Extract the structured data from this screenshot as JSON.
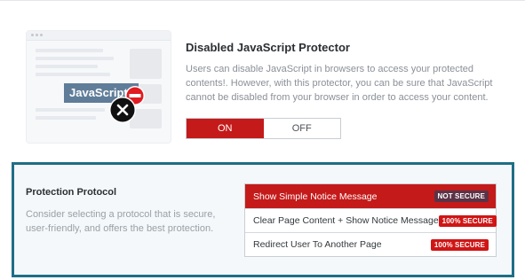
{
  "illustration": {
    "label": "JavaScript",
    "icons": [
      "no-entry-icon",
      "close-circle-icon"
    ]
  },
  "protector": {
    "title": "Disabled JavaScript Protector",
    "description": "Users can disable JavaScript in browsers to access your protected contents!. However, with this protector, you can be sure that JavaScript cannot be disabled from your browser in order to access your content.",
    "toggle": {
      "on_label": "ON",
      "off_label": "OFF",
      "selected": "ON"
    }
  },
  "protocol": {
    "title": "Protection Protocol",
    "description": "Consider selecting a protocol that is secure, user-friendly, and offers the best protection.",
    "options": [
      {
        "label": "Show Simple Notice Message",
        "badge": "NOT SECURE",
        "selected": true
      },
      {
        "label": "Clear Page Content + Show Notice Message",
        "badge": "100% SECURE",
        "selected": false
      },
      {
        "label": "Redirect User To Another Page",
        "badge": "100% SECURE",
        "selected": false
      }
    ]
  },
  "colors": {
    "accent_red": "#c41a1a",
    "panel_border": "#1f6e86",
    "not_secure_badge": "#5b3346",
    "secure_badge": "#d01515"
  }
}
